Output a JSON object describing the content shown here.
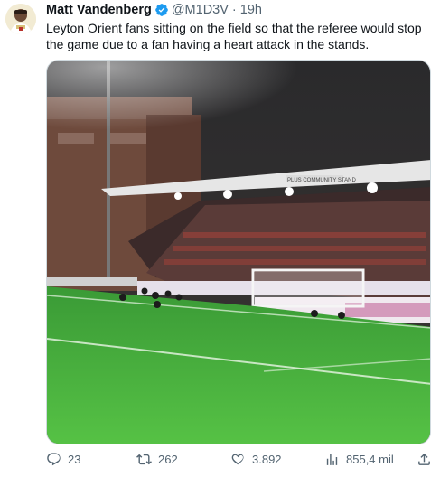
{
  "author": {
    "display_name": "Matt Vandenberg",
    "handle": "@M1D3V",
    "separator": "·",
    "time": "19h",
    "verified_color": "#1d9bf0"
  },
  "tweet": {
    "text": "Leyton Orient fans sitting on the field so that the referee would stop the game due to a fan having a heart attack in the stands."
  },
  "media": {
    "stand_sign": "PLUS COMMUNITY STAND"
  },
  "actions": {
    "reply_count": "23",
    "retweet_count": "262",
    "like_count": "3.892",
    "views_count": "855,4 mil"
  },
  "colors": {
    "text_primary": "#0f1419",
    "text_secondary": "#536471",
    "pitch_green": "#4cb43c"
  }
}
